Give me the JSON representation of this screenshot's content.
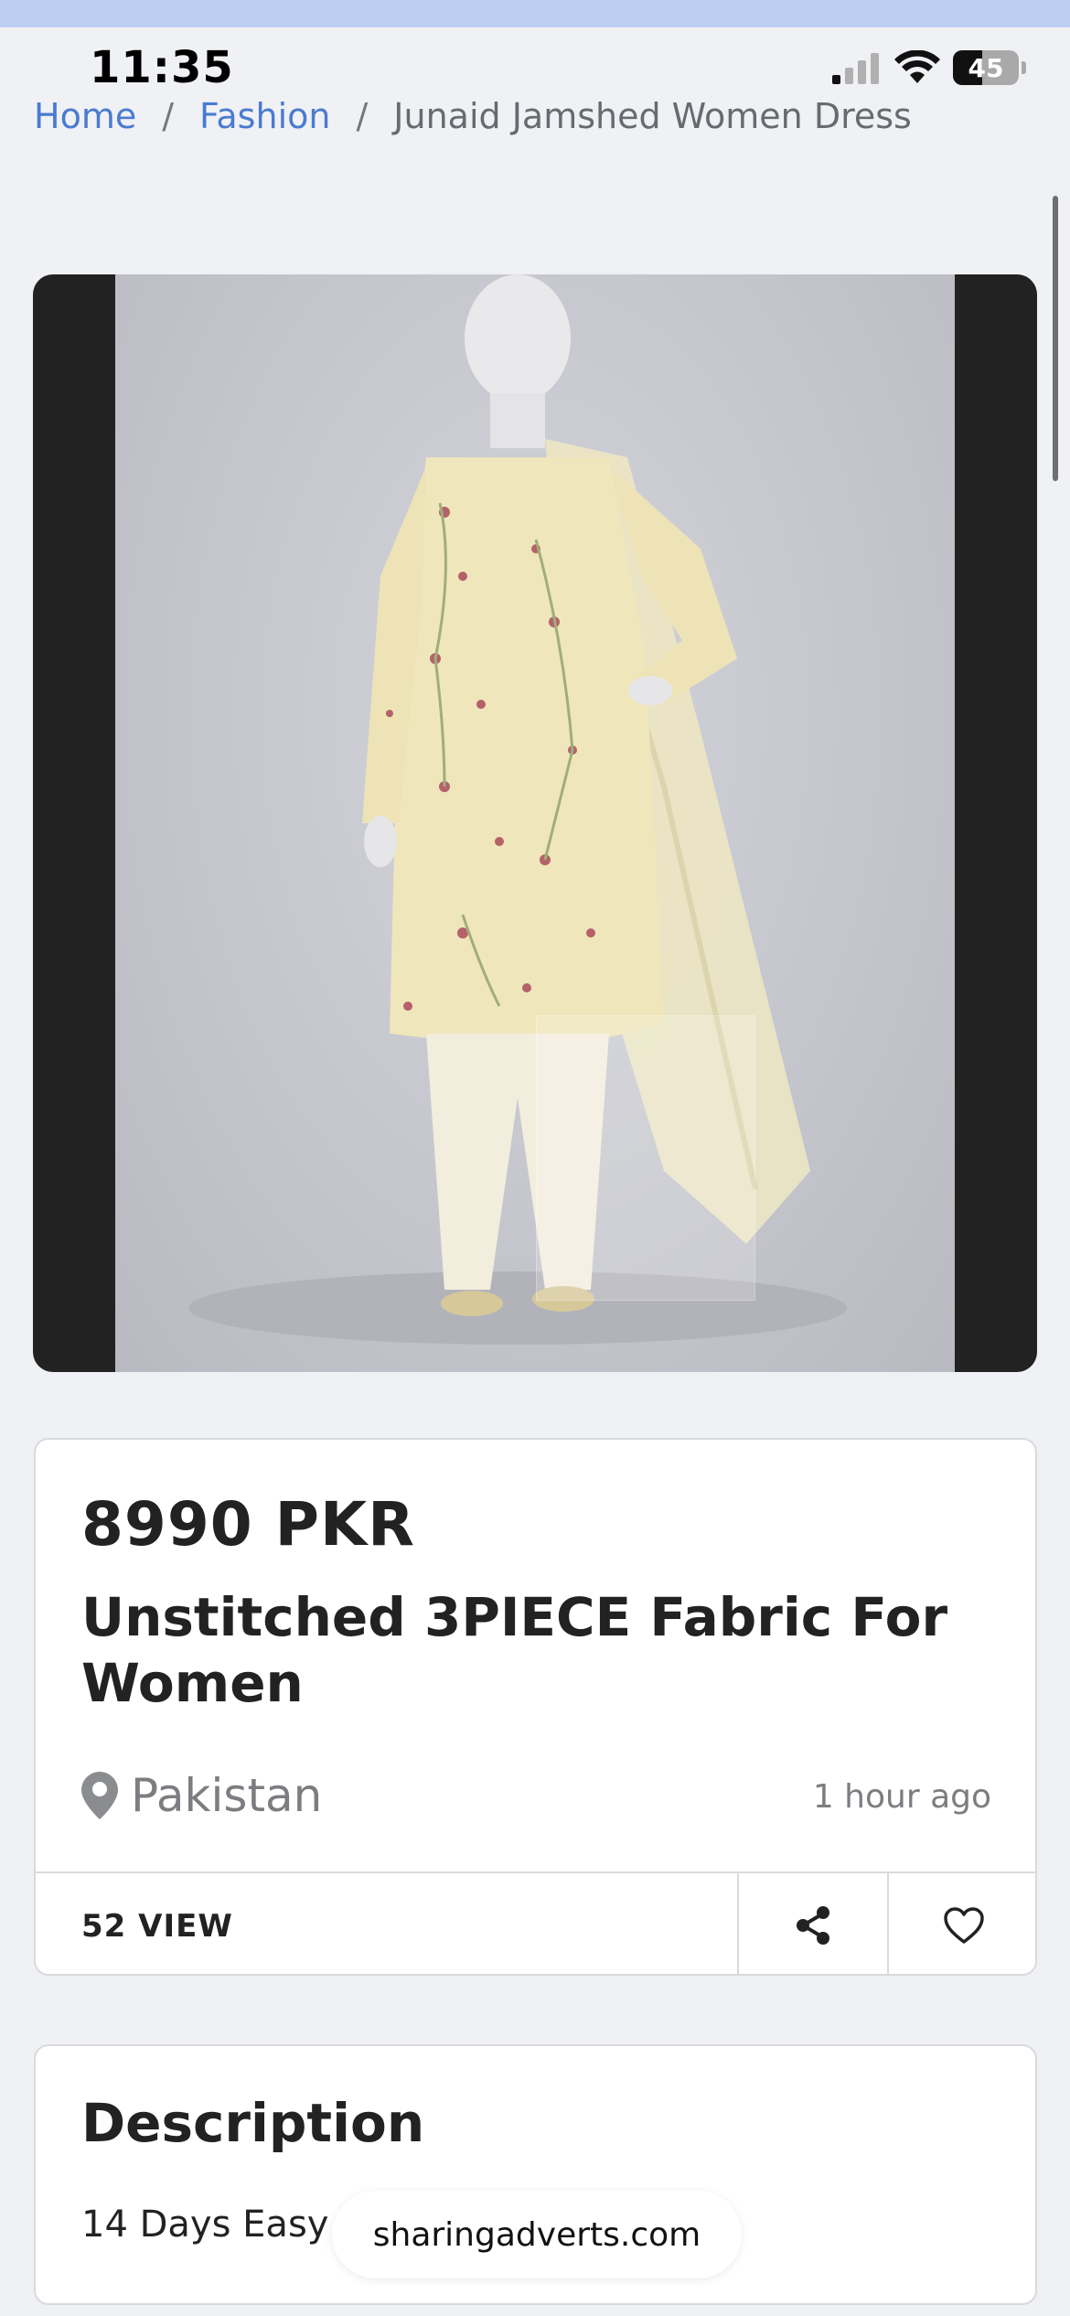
{
  "status_bar": {
    "time": "11:35",
    "battery": "45"
  },
  "breadcrumb": [
    {
      "label": "Home"
    },
    {
      "label": "Fashion"
    },
    {
      "label": "Junaid Jamshed Women Dress"
    }
  ],
  "breadcrumb_separator": "/",
  "gallery": {
    "main_icon": "product-photo-dress"
  },
  "listing": {
    "price": "8990 PKR",
    "title": "Unstitched 3PIECE Fabric For Women",
    "location": "Pakistan",
    "posted": "1 hour ago",
    "views": "52 VIEW"
  },
  "description": {
    "heading": "Description",
    "text": "14 Days Easy Return"
  },
  "toast": {
    "domain": "sharingadverts.com"
  },
  "colors": {
    "accent": "#4a7bd0",
    "top_bar": "#bccdf2",
    "background": "#f0f1f5"
  }
}
